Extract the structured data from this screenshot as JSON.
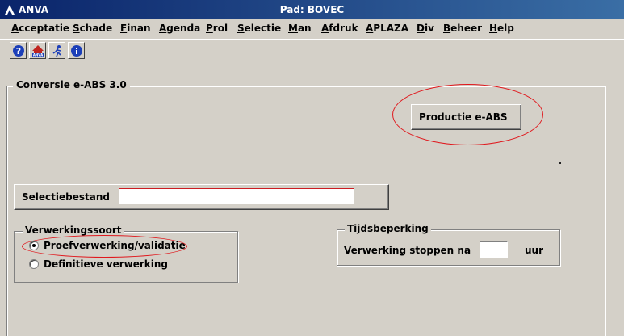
{
  "titlebar": {
    "app_name": "ANVA",
    "window_title": "Pad: BOVEC"
  },
  "menu": [
    {
      "label": "Acceptatie"
    },
    {
      "label": "Schade"
    },
    {
      "label": "Finan"
    },
    {
      "label": "Agenda"
    },
    {
      "label": "Prol"
    },
    {
      "label": "Selectie"
    },
    {
      "label": "Man"
    },
    {
      "label": "Afdruk"
    },
    {
      "label": "APLAZA"
    },
    {
      "label": "Div"
    },
    {
      "label": "Beheer"
    },
    {
      "label": "Help"
    }
  ],
  "toolbar": {
    "icons": [
      "help-icon",
      "anva-home-icon",
      "run-icon",
      "info-icon"
    ]
  },
  "form": {
    "title": "Conversie e-ABS 3.0",
    "productie_button": "Productie e-ABS",
    "selectie_label": "Selectiebestand",
    "selectie_value": "",
    "verwerkingssoort": {
      "title": "Verwerkingssoort",
      "options": [
        {
          "label": "Proefverwerking/validatie",
          "checked": true
        },
        {
          "label": "Definitieve verwerking",
          "checked": false
        }
      ]
    },
    "tijdsbeperking": {
      "title": "Tijdsbeperking",
      "label": "Verwerking stoppen na",
      "value": "",
      "unit": "uur"
    }
  },
  "colors": {
    "highlight": "#e0181d",
    "background": "#d4d0c8",
    "titlebar": "#0a246a"
  }
}
